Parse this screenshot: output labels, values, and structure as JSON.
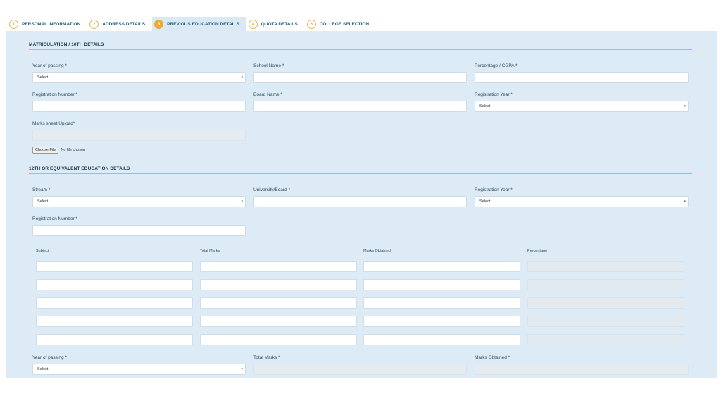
{
  "stepper": [
    {
      "num": "1",
      "label": "PERSONAL INFORMATION"
    },
    {
      "num": "2",
      "label": "ADDRESS DETAILS"
    },
    {
      "num": "3",
      "label": "PREVIOUS EDUCATION DETAILS"
    },
    {
      "num": "4",
      "label": "QUOTA DETAILS"
    },
    {
      "num": "5",
      "label": "COLLEGE SELECTION"
    }
  ],
  "matric": {
    "title": "MATRICULATION / 10TH DETAILS",
    "year_label": "Year of passing *",
    "year_value": "Select",
    "school_label": "School Name *",
    "percent_label": "Percentage / CGPA *",
    "reg_no_label": "Registration Number *",
    "board_label": "Board Name *",
    "reg_year_label": "Registration Year *",
    "reg_year_value": "Select",
    "marks_upload_label": "Marks sheet Upload*",
    "choose_file": "Choose File",
    "no_file": "No file chosen"
  },
  "twelfth": {
    "title": "12TH OR EQUIVALENT EDUCATION DETAILS",
    "stream_label": "Stream *",
    "stream_value": "Select",
    "board_label": "University/Board *",
    "reg_year_label": "Registration Year *",
    "reg_year_value": "Select",
    "reg_no_label": "Registration Number *",
    "table_headers": [
      "Subject",
      "Total Marks",
      "Marks Obtained",
      "Percentage"
    ],
    "year_label": "Year of passing *",
    "year_value": "Select",
    "total_marks_label": "Total Marks *",
    "marks_obtained_label": "Marks Obtained *"
  }
}
